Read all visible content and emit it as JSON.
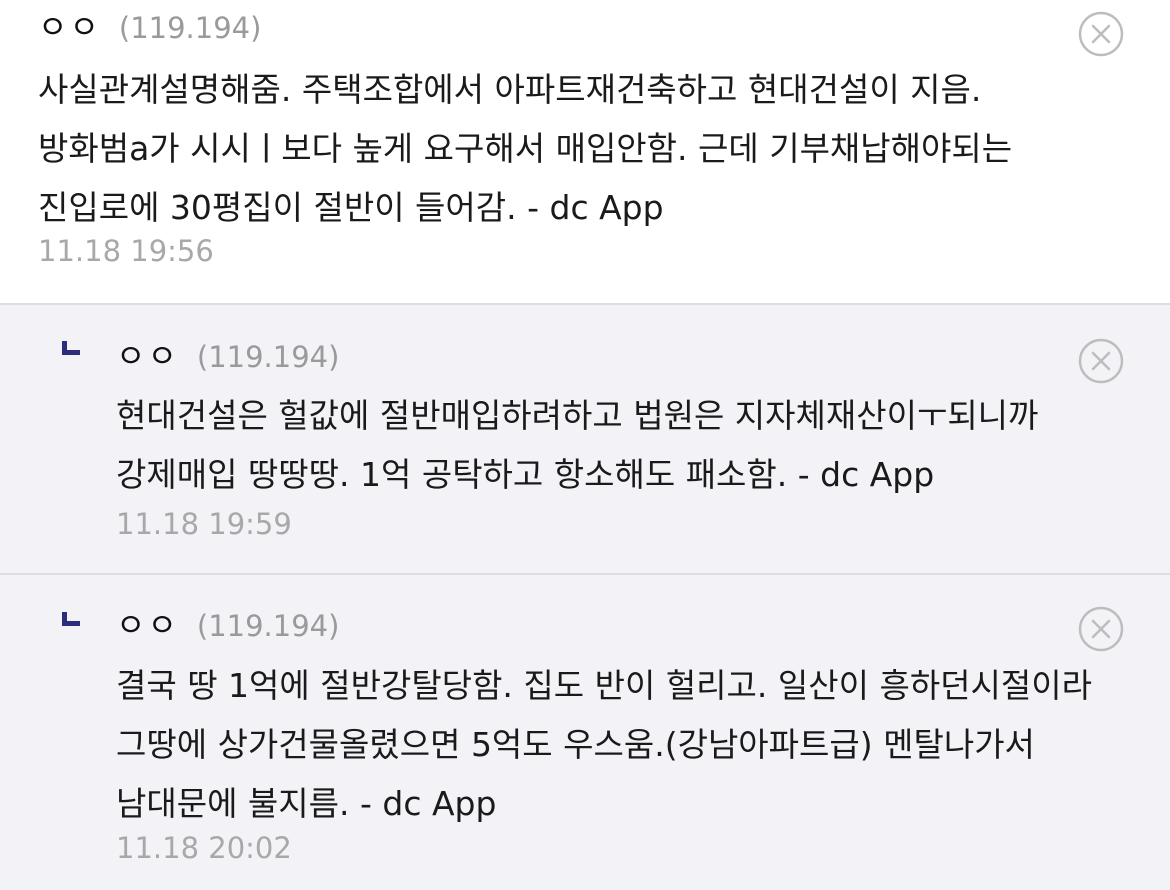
{
  "comments": [
    {
      "nickname": "ㅇㅇ",
      "ip": "(119.194)",
      "text": "사실관계설명해줌. 주택조합에서 아파트재건축하고 현대건설이 지음. 방화범a가 시시ㅣ보다 높게 요구해서 매입안함. 근데 기부채납해야되는 진입로에 30평집이 절반이 들어감. - dc App",
      "time": "11.18 19:56"
    },
    {
      "nickname": "ㅇㅇ",
      "ip": "(119.194)",
      "text": "현대건설은 헐값에 절반매입하려하고 법원은 지자체재산이ㅜ되니까 강제매입 땅땅땅. 1억 공탁하고 항소해도 패소함. - dc App",
      "time": "11.18 19:59"
    },
    {
      "nickname": "ㅇㅇ",
      "ip": "(119.194)",
      "text": "결국 땅 1억에 절반강탈당함. 집도 반이 헐리고. 일산이 흥하던시절이라 그땅에 상가건물올렸으면 5억도 우스움.(강남아파트급) 멘탈나가서 남대문에 불지름. - dc App",
      "time": "11.18 20:02"
    }
  ],
  "icons": {
    "delete": "close-circle-icon",
    "reply": "reply-arrow-icon"
  },
  "colors": {
    "reply_background": "#f3f3f7",
    "reply_marker": "#2b2d7a",
    "meta_text": "#9a9a9a"
  }
}
